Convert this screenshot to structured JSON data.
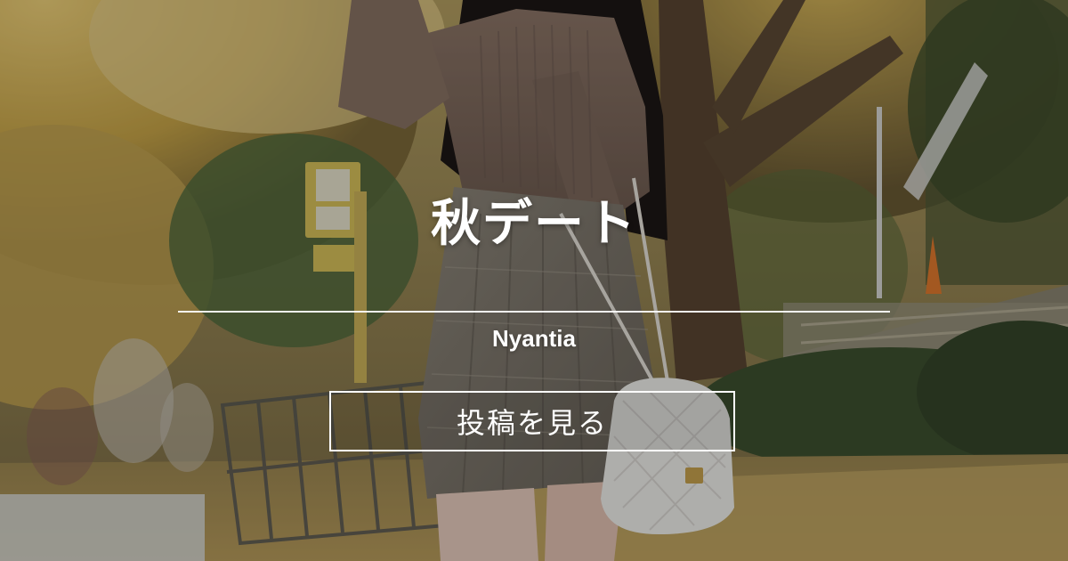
{
  "card": {
    "title": "秋デート",
    "author": "Nyantia",
    "cta_label": "投稿を見る"
  },
  "background": {
    "description_icon": "autumn-park-photo"
  },
  "colors": {
    "text": "#ffffff",
    "divider": "#ffffff",
    "overlay": "rgba(0,0,0,0.28)"
  }
}
